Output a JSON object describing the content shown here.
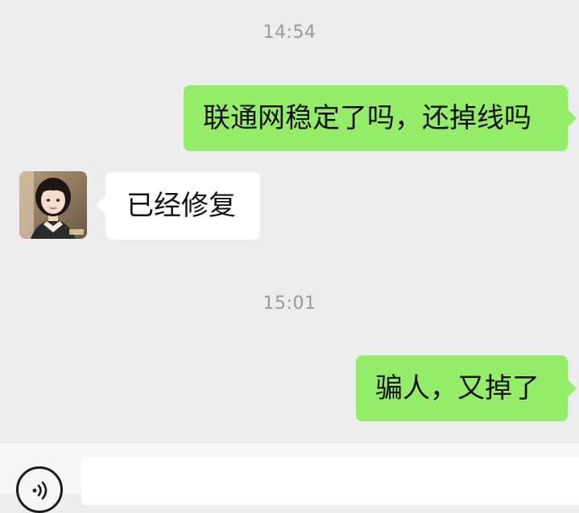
{
  "messages": [
    {
      "type": "timestamp",
      "text": "14:54"
    },
    {
      "type": "outgoing",
      "text": "联通网稳定了吗，还掉线吗"
    },
    {
      "type": "incoming",
      "sender_avatar": "contact-avatar",
      "text": "已经修复"
    },
    {
      "type": "timestamp",
      "text": "15:01"
    },
    {
      "type": "outgoing",
      "text": "骗人，又掉了"
    }
  ],
  "input_bar": {
    "voice_icon": "voice-icon",
    "text_value": "",
    "text_placeholder": ""
  },
  "colors": {
    "chat_background": "#ededed",
    "outgoing_bubble": "#95ec69",
    "incoming_bubble": "#ffffff",
    "timestamp_text": "#9a9a9a",
    "input_bar_background": "#f7f7f7"
  }
}
